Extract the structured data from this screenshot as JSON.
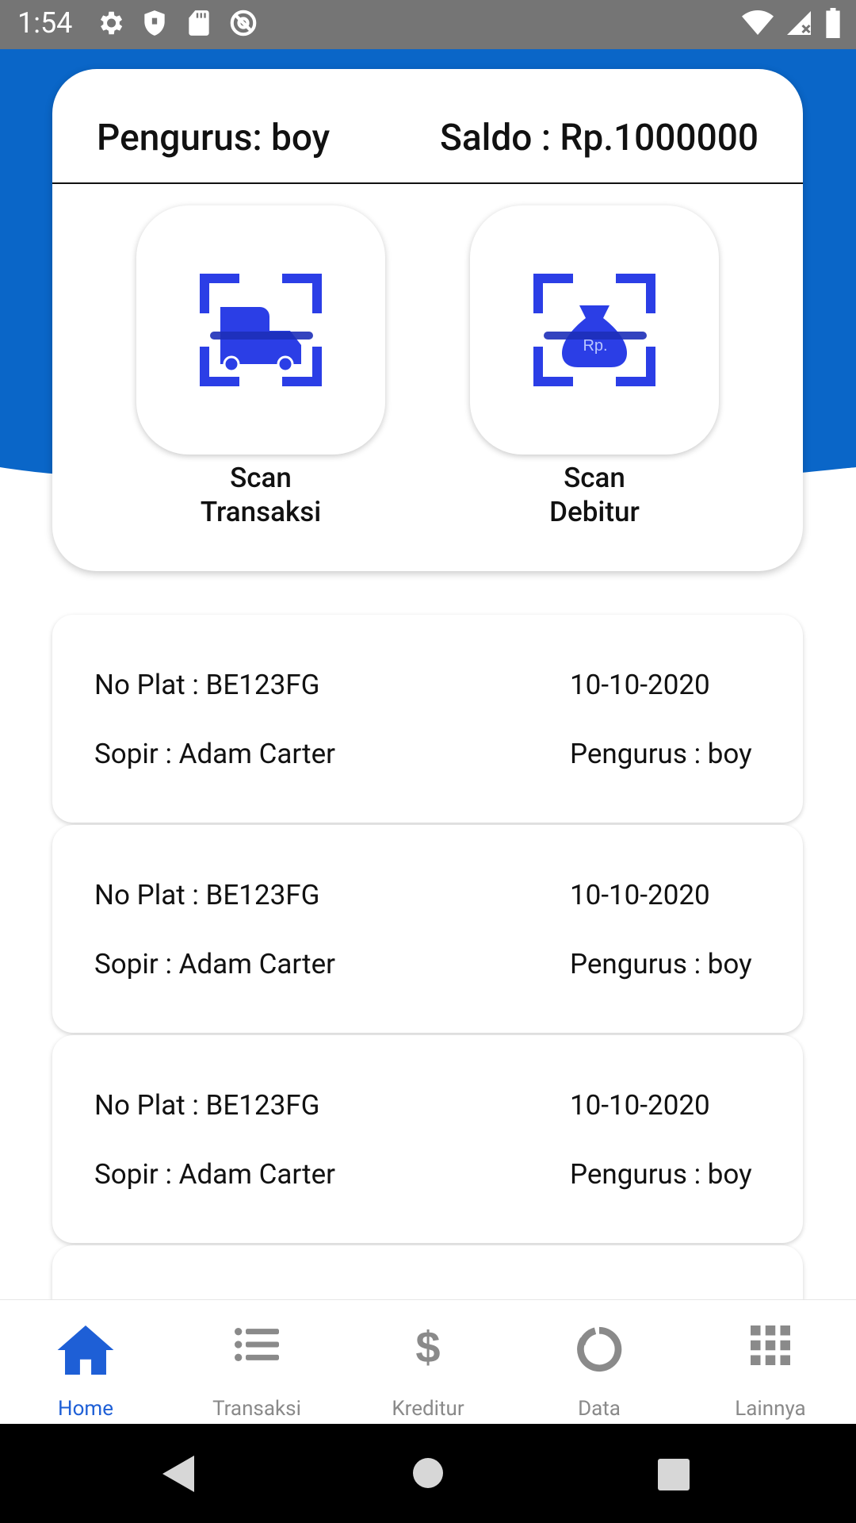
{
  "status_bar": {
    "time": "1:54",
    "left_icons": [
      "gear-icon",
      "shield-icon",
      "sd-card-icon",
      "at-sign-icon"
    ],
    "right_icons": [
      "wifi-icon",
      "signal-icon",
      "battery-icon"
    ]
  },
  "colors": {
    "primary_blue": "#0a66c8",
    "icon_blue": "#2b3ee6",
    "active_nav": "#1e5fd6",
    "inactive_nav": "#8a8a8a"
  },
  "header": {
    "pengurus": "Pengurus: boy",
    "saldo": "Saldo : Rp.1000000"
  },
  "scan_actions": [
    {
      "label_line1": "Scan",
      "label_line2": "Transaksi",
      "icon": "truck-scan-icon"
    },
    {
      "label_line1": "Scan",
      "label_line2": "Debitur",
      "icon": "money-bag-scan-icon",
      "icon_text": "Rp."
    }
  ],
  "transactions": [
    {
      "no_plat": "No Plat : BE123FG",
      "date": "10-10-2020",
      "sopir": "Sopir : Adam Carter",
      "pengurus": "Pengurus : boy"
    },
    {
      "no_plat": "No Plat : BE123FG",
      "date": "10-10-2020",
      "sopir": "Sopir : Adam Carter",
      "pengurus": "Pengurus : boy"
    },
    {
      "no_plat": "No Plat : BE123FG",
      "date": "10-10-2020",
      "sopir": "Sopir : Adam Carter",
      "pengurus": "Pengurus : boy"
    }
  ],
  "bottom_nav": [
    {
      "label": "Home",
      "icon": "home-icon",
      "active": true
    },
    {
      "label": "Transaksi",
      "icon": "list-icon",
      "active": false
    },
    {
      "label": "Kreditur",
      "icon": "dollar-icon",
      "active": false
    },
    {
      "label": "Data",
      "icon": "donut-chart-icon",
      "active": false
    },
    {
      "label": "Lainnya",
      "icon": "grid-icon",
      "active": false
    }
  ],
  "system_nav": [
    "back-icon",
    "home-circle-icon",
    "recents-icon"
  ]
}
